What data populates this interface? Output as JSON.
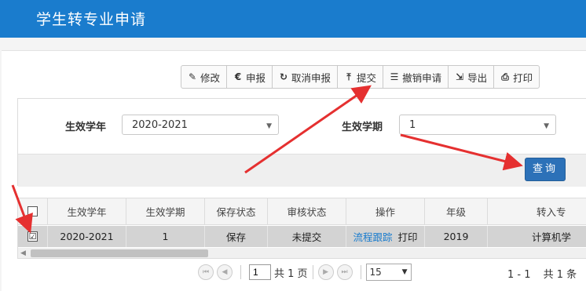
{
  "header": {
    "title": "学生转专业申请"
  },
  "toolbar": {
    "buttons": [
      {
        "label": "修改",
        "icon": "edit-icon"
      },
      {
        "label": "申报",
        "icon": "euro-icon"
      },
      {
        "label": "取消申报",
        "icon": "refresh-icon"
      },
      {
        "label": "提交",
        "icon": "upload-icon"
      },
      {
        "label": "撤销申请",
        "icon": "list-icon"
      },
      {
        "label": "导出",
        "icon": "export-icon"
      },
      {
        "label": "打印",
        "icon": "print-icon"
      }
    ]
  },
  "search": {
    "year_label": "生效学年",
    "year_value": "2020-2021",
    "term_label": "生效学期",
    "term_value": "1",
    "query_label": "查询"
  },
  "table": {
    "columns": [
      "生效学年",
      "生效学期",
      "保存状态",
      "审核状态",
      "操作",
      "年级",
      "转入专"
    ],
    "rows": [
      {
        "checked": "☑",
        "year": "2020-2021",
        "term": "1",
        "save_status": "保存",
        "review_status": "未提交",
        "op_link": "流程跟踪",
        "op_print": "打印",
        "grade": "2019",
        "major": "计算机学"
      }
    ]
  },
  "pager": {
    "page": "1",
    "total_pages_text": "共 1 页",
    "page_size": "15",
    "range_text": "1 - 1",
    "total_text": "共 1 条"
  },
  "colors": {
    "header_bg": "#1a7ccd",
    "accent": "#2c71b8",
    "arrow": "#e53030"
  }
}
